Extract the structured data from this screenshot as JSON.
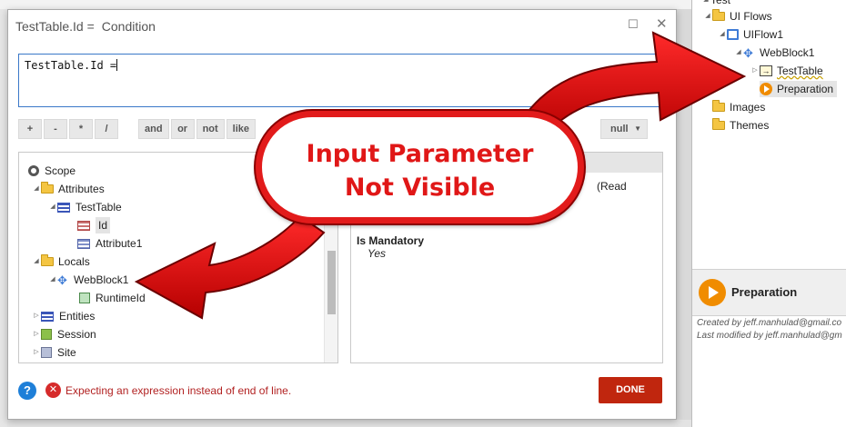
{
  "dialog": {
    "title_field": "TestTable.Id =",
    "title_condition": "Condition",
    "expression": "TestTable.Id =",
    "operators": [
      "+",
      "-",
      "*",
      "/",
      "and",
      "or",
      "not",
      "like"
    ],
    "null_label": "null",
    "scope": {
      "root": "Scope",
      "attributes": "Attributes",
      "testtable": "TestTable",
      "id": "Id",
      "attribute1": "Attribute1",
      "locals": "Locals",
      "webblock": "WebBlock1",
      "runtimeid": "RuntimeId",
      "entities": "Entities",
      "session": "Session",
      "site": "Site"
    },
    "details": {
      "read_text": "(Read",
      "mandatory_label": "Is Mandatory",
      "mandatory_value": "Yes"
    },
    "error_message": "Expecting an expression instead of end of line.",
    "done_label": "DONE"
  },
  "tree": {
    "test": "Test",
    "ui_flows": "UI Flows",
    "uiflow1": "UIFlow1",
    "webblock1": "WebBlock1",
    "testtable": "TestTable",
    "preparation": "Preparation",
    "images": "Images",
    "themes": "Themes"
  },
  "properties": {
    "title": "Preparation",
    "created_by": "Created by jeff.manhulad@gmail.co",
    "modified_by": "Last modified by jeff.manhulad@gm"
  },
  "callout": {
    "line1": "Input Parameter",
    "line2": "Not Visible"
  },
  "colors": {
    "accent_red": "#e21b1b",
    "done_red": "#c0260e",
    "selection_blue": "#3a78c8"
  }
}
